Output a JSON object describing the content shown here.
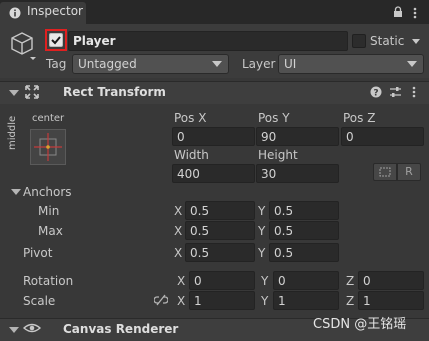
{
  "tab": {
    "title": "Inspector"
  },
  "object": {
    "enabled": true,
    "name": "Player",
    "static_label": "Static",
    "tag_label": "Tag",
    "tag_value": "Untagged",
    "layer_label": "Layer",
    "layer_value": "UI"
  },
  "rect_transform": {
    "title": "Rect Transform",
    "anchor_preset_h": "center",
    "anchor_preset_v": "middle",
    "pos_x_label": "Pos X",
    "pos_y_label": "Pos Y",
    "pos_z_label": "Pos Z",
    "pos_x": "0",
    "pos_y": "90",
    "pos_z": "0",
    "width_label": "Width",
    "height_label": "Height",
    "width": "400",
    "height": "30",
    "raw_edit_label": "R",
    "anchors_label": "Anchors",
    "min_label": "Min",
    "max_label": "Max",
    "anchor_min_x": "0.5",
    "anchor_min_y": "0.5",
    "anchor_max_x": "0.5",
    "anchor_max_y": "0.5",
    "pivot_label": "Pivot",
    "pivot_x": "0.5",
    "pivot_y": "0.5",
    "rotation_label": "Rotation",
    "rot_x": "0",
    "rot_y": "0",
    "rot_z": "0",
    "scale_label": "Scale",
    "scale_x": "1",
    "scale_y": "1",
    "scale_z": "1",
    "axis_x": "X",
    "axis_y": "Y",
    "axis_z": "Z"
  },
  "canvas_renderer": {
    "title": "Canvas Renderer"
  },
  "watermark": "CSDN @王铭瑶",
  "colors": {
    "highlight": "#e02020",
    "background": "#383838",
    "field": "#2a2a2a"
  }
}
